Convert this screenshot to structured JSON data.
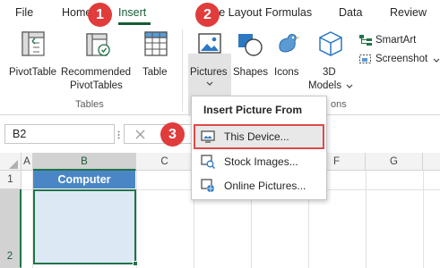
{
  "menu_tabs": [
    "File",
    "Home",
    "Insert",
    "Page Layout",
    "Formulas",
    "Data",
    "Review"
  ],
  "ribbon": {
    "pivottable": "PivotTable",
    "recommended_line1": "Recommended",
    "recommended_line2": "PivotTables",
    "table": "Table",
    "tables_group": "Tables",
    "pictures": "Pictures",
    "shapes": "Shapes",
    "icons": "Icons",
    "models_line1": "3D",
    "models_line2": "Models",
    "smartart": "SmartArt",
    "screenshot": "Screenshot",
    "illustrations_group_partial": "ons"
  },
  "badges": [
    "1",
    "2",
    "3"
  ],
  "formula_bar": {
    "name_box": "B2",
    "cancel_icon": "close-icon"
  },
  "dropdown": {
    "title": "Insert Picture From",
    "items": [
      "This Device...",
      "Stock Images...",
      "Online Pictures..."
    ]
  },
  "grid": {
    "columns": [
      "A",
      "B",
      "C",
      "D",
      "E",
      "F",
      "G"
    ],
    "rows": [
      "1",
      "2"
    ],
    "b1_value": "Computer",
    "b1_fill": "#4a86c5",
    "selection_color": "#217346"
  },
  "colors": {
    "accent": "#185c37",
    "badge": "#e03c3c"
  }
}
